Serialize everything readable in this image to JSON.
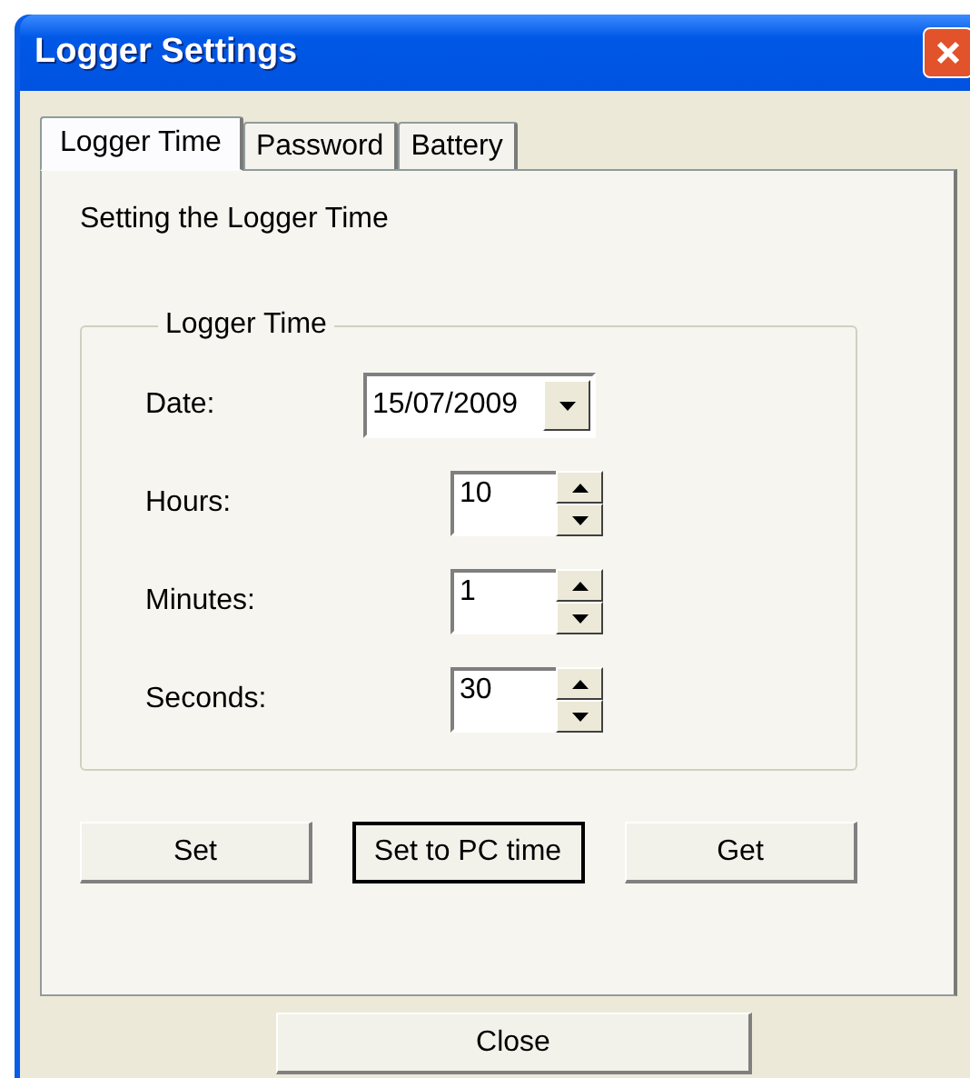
{
  "window": {
    "title": "Logger Settings"
  },
  "tabs": [
    {
      "label": "Logger Time",
      "selected": true
    },
    {
      "label": "Password",
      "selected": false
    },
    {
      "label": "Battery",
      "selected": false
    }
  ],
  "heading": "Setting the Logger Time",
  "group": {
    "title": "Logger Time",
    "fields": [
      {
        "kind": "date",
        "label": "Date:",
        "value": "15/07/2009"
      },
      {
        "kind": "spin",
        "label": "Hours:",
        "value": "10"
      },
      {
        "kind": "spin",
        "label": "Minutes:",
        "value": "1"
      },
      {
        "kind": "spin",
        "label": "Seconds:",
        "value": "30"
      }
    ]
  },
  "buttons": [
    {
      "label": "Set",
      "default": false
    },
    {
      "label": "Set to PC time",
      "default": true
    },
    {
      "label": "Get",
      "default": false
    }
  ],
  "close_button": "Close"
}
